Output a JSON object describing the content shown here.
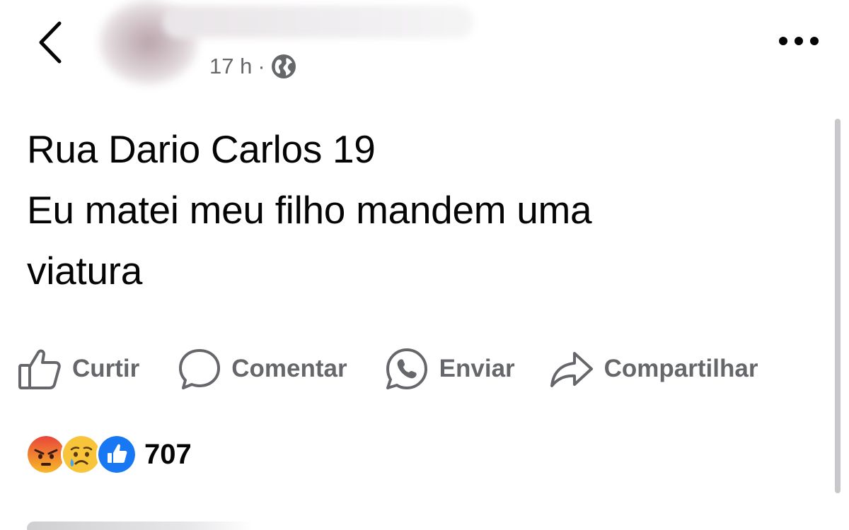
{
  "header": {
    "back_icon": "chevron-left-icon",
    "time": "17 h",
    "separator": "·",
    "privacy_icon": "globe-icon",
    "more_icon": "more-horizontal-icon"
  },
  "post": {
    "lines": [
      "Rua Dario Carlos 19",
      "Eu matei meu filho mandem uma",
      "viatura"
    ]
  },
  "actions": {
    "like": {
      "label": "Curtir",
      "icon": "thumbs-up-icon"
    },
    "comment": {
      "label": "Comentar",
      "icon": "comment-bubble-icon"
    },
    "send": {
      "label": "Enviar",
      "icon": "whatsapp-icon"
    },
    "share": {
      "label": "Compartilhar",
      "icon": "share-arrow-icon"
    }
  },
  "reactions": {
    "types": [
      "angry",
      "sad",
      "like"
    ],
    "count": "707"
  },
  "colors": {
    "text": "#050505",
    "secondary": "#65676b",
    "like_blue": "#1877f2",
    "angry_red": "#f0553e",
    "sad_yellow": "#f7b928"
  }
}
